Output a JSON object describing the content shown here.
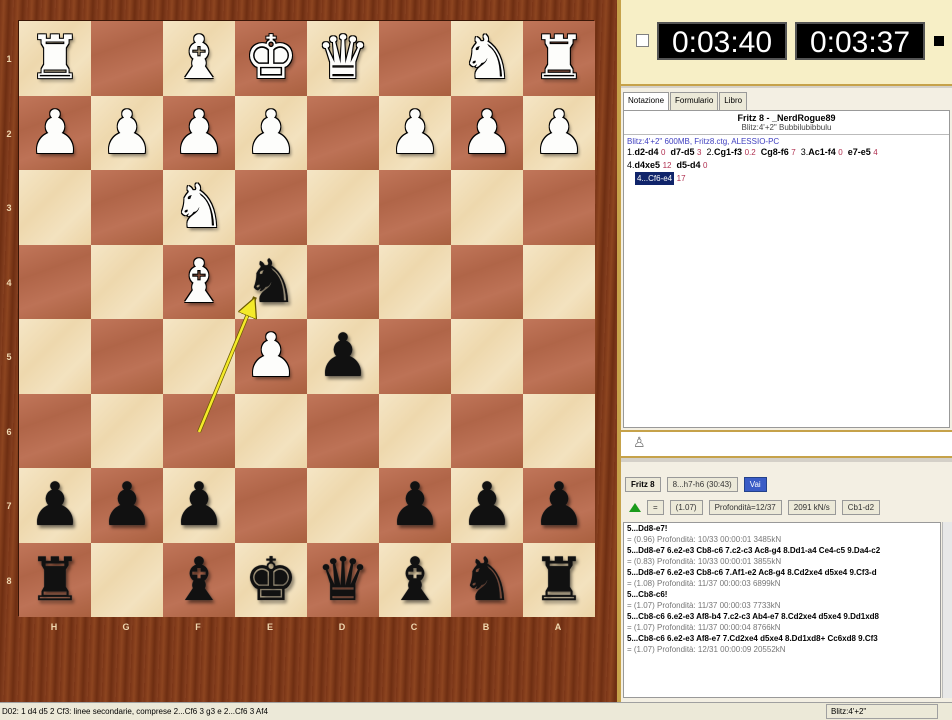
{
  "board": {
    "ranks": [
      "1",
      "2",
      "3",
      "4",
      "5",
      "6",
      "7",
      "8"
    ],
    "files": [
      "H",
      "G",
      "F",
      "E",
      "D",
      "C",
      "B",
      "A"
    ],
    "squares": [
      [
        "wR",
        "",
        "wB",
        "wK",
        "wQ",
        "",
        "wN",
        "wR"
      ],
      [
        "wP",
        "wP",
        "wP",
        "wP",
        "",
        "wP",
        "wP",
        "wP"
      ],
      [
        "",
        "",
        "wN",
        "",
        "",
        "",
        "",
        ""
      ],
      [
        "",
        "",
        "wB",
        "bN",
        "",
        "",
        "",
        ""
      ],
      [
        "",
        "",
        "",
        "wP",
        "bP",
        "",
        "",
        ""
      ],
      [
        "",
        "",
        "",
        "",
        "",
        "",
        "",
        ""
      ],
      [
        "bP",
        "bP",
        "bP",
        "",
        "",
        "bP",
        "bP",
        "bP"
      ],
      [
        "bR",
        "",
        "bB",
        "bK",
        "bQ",
        "bB",
        "bN",
        "bR"
      ]
    ]
  },
  "glyphs": {
    "K": "♚",
    "Q": "♛",
    "R": "♜",
    "B": "♝",
    "N": "♞",
    "P": "♟"
  },
  "colors": {
    "light_square": "#f0dcb4",
    "dark_square": "#b46a4c",
    "arrow": "#f4ea2a",
    "frame": "#7a3517"
  },
  "clocks": {
    "white": "0:03:40",
    "black": "0:03:37"
  },
  "notation": {
    "tabs": [
      "Notazione",
      "Formulario",
      "Libro"
    ],
    "title": "Fritz 8 - _NerdRogue89",
    "subtitle": "Blitz:4'+2\" Bubbilubibbulu",
    "meta": "Blitz:4'+2\"  600MB, Fritz8.ctg, ALESSIO-PC",
    "moves": [
      {
        "n": "1.",
        "w": "d2-d4",
        "wt": "0",
        "b": "d7-d5",
        "bt": "3"
      },
      {
        "n": "2.",
        "w": "Cg1-f3",
        "wt": "0.2",
        "b": "Cg8-f6",
        "bt": "7"
      },
      {
        "n": "3.",
        "w": "Ac1-f4",
        "wt": "0",
        "b": "e7-e5",
        "bt": "4"
      },
      {
        "n": "4.",
        "w": "d4xe5",
        "wt": "12",
        "b": "d5-d4",
        "bt": "0"
      }
    ],
    "current_move": "4...Cf6-e4",
    "current_time": "17"
  },
  "engine": {
    "name": "Fritz 8",
    "line": "8...h7-h6 (30:43)",
    "go": "Vai",
    "eval": "=",
    "score": "(1.07)",
    "depth": "Profondità=12/37",
    "speed": "2091 kN/s",
    "best": "Cb1-d2",
    "analysis": [
      {
        "type": "head",
        "text": "5...Dd8-e7!"
      },
      {
        "type": "info",
        "text": "= (0.96)  Profondità: 10/33   00:00:01  3485kN"
      },
      {
        "type": "head",
        "text": "5...Dd8-e7 6.e2-e3 Cb8-c6 7.c2-c3 Ac8-g4 8.Dd1-a4 Ce4-c5 9.Da4-c2"
      },
      {
        "type": "info",
        "text": "= (0.83)  Profondità: 10/33   00:00:01  3855kN"
      },
      {
        "type": "head",
        "text": "5...Dd8-e7 6.e2-e3 Cb8-c6 7.Af1-e2 Ac8-g4 8.Cd2xe4 d5xe4 9.Cf3-d"
      },
      {
        "type": "info",
        "text": "= (1.08)  Profondità: 11/37   00:00:03  6899kN"
      },
      {
        "type": "head",
        "text": "5...Cb8-c6!"
      },
      {
        "type": "info",
        "text": "= (1.07)  Profondità: 11/37   00:00:03  7733kN"
      },
      {
        "type": "head",
        "text": "5...Cb8-c6 6.e2-e3 Af8-b4 7.c2-c3 Ab4-e7 8.Cd2xe4 d5xe4 9.Dd1xd8"
      },
      {
        "type": "info",
        "text": "= (1.07)  Profondità: 11/37   00:00:04  8766kN"
      },
      {
        "type": "head",
        "text": "5...Cb8-c6 6.e2-e3 Af8-e7 7.Cd2xe4 d5xe4 8.Dd1xd8+ Cc6xd8 9.Cf3"
      },
      {
        "type": "info",
        "text": "= (1.07)  Profondità: 12/31   00:00:09  20552kN"
      }
    ]
  },
  "status": {
    "left": "D02: 1 d4 d5 2 Cf3: linee secondarie, comprese 2...Cf6 3 g3 e 2...Cf6 3 Af4",
    "right": "Blitz:4'+2\""
  }
}
